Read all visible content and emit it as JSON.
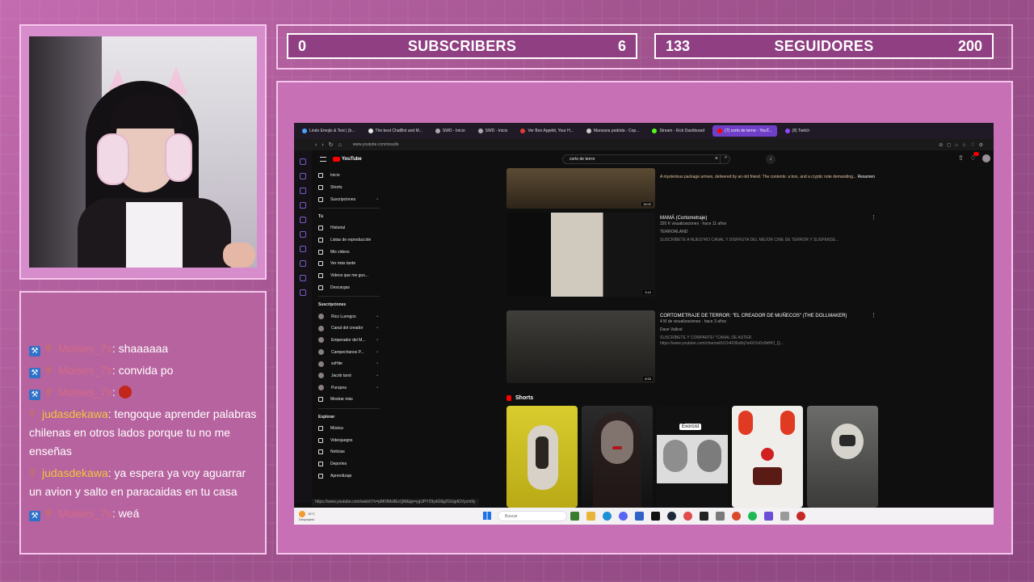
{
  "counters": {
    "youtube": {
      "current": "0",
      "label": "SUBSCRIBERS",
      "goal": "6"
    },
    "twitch": {
      "current": "133",
      "label": "SEGUIDORES",
      "goal": "200"
    }
  },
  "chat": [
    {
      "user": "Moises_7s",
      "text": ": shaaaaaa",
      "badge": true,
      "color": "#d46b86"
    },
    {
      "user": "Moises_7s",
      "text": ": convida po",
      "badge": true,
      "color": "#d46b86"
    },
    {
      "user": "Moises_7s",
      "text": ": ",
      "badge": true,
      "emote": true,
      "color": "#d46b86"
    },
    {
      "user": "judasdekawa",
      "text": ": tengoque aprender palabras chilenas en otros lados porque tu no me enseñas",
      "badge": false,
      "color": "#f2c53d"
    },
    {
      "user": "judasdekawa",
      "text": ": ya espera ya voy aguarrar un avion y salto en paracaidas en tu casa",
      "badge": false,
      "color": "#f2c53d"
    },
    {
      "user": "Moises_7s",
      "text": ": weá",
      "badge": true,
      "color": "#d46b86"
    }
  ],
  "browser": {
    "tabs": [
      {
        "label": "Lindo Emojis & Text | (b...",
        "color": "#4aa3ff"
      },
      {
        "label": "The best ChatBot and M...",
        "color": "#e9e9e9"
      },
      {
        "label": "SWD - Inicio",
        "color": "#aaaaaa"
      },
      {
        "label": "SWD - Inicio",
        "color": "#aaaaaa"
      },
      {
        "label": "Ver Bon Appétit, Your H...",
        "color": "#e53935"
      },
      {
        "label": "Manzana podrida - Cop...",
        "color": "#cccccc"
      },
      {
        "label": "Stream - Kick Dashboard",
        "color": "#53fc18"
      },
      {
        "label": "(7) corto de terror - YouT...",
        "color": "#ff0000",
        "active": true
      },
      {
        "label": "(8) Twitch",
        "color": "#9146ff"
      }
    ],
    "url": "www.youtube.com/results",
    "status_url": "https://www.youtube.com/watch?v=p8K9Mx8EcQM&pp=ygUPY29ydG8gZGUgdGVycm9y"
  },
  "youtube": {
    "logo": "YouTube",
    "search_query": "corto de terror",
    "sidebar": {
      "main": [
        "Inicio",
        "Shorts",
        "Suscripciones"
      ],
      "tu_header": "Tú",
      "you": [
        "Historial",
        "Listas de reproducción",
        "Mis videos",
        "Ver más tarde",
        "Videos que me gus..."
      ],
      "downloads": "Descargas",
      "subs_header": "Suscripciones",
      "subs": [
        "Rico Luengos",
        "Canal del creador",
        "Emperador del M...",
        "Campechanos P...",
        "sxHite",
        "Jacob tarot",
        "Purupea"
      ],
      "show_more": "Mostrar más",
      "explore_header": "Explorar",
      "explore": [
        "Música",
        "Videojuegos",
        "Noticias",
        "Deportes",
        "Aprendizaje"
      ]
    },
    "videos": [
      {
        "title": "",
        "desc": "A mysterious package arrives, delivered by an old friend. The contents: a box, and a cryptic note demanding...",
        "duration": "15:02",
        "resumen": "Resumen"
      },
      {
        "title": "MAMÁ (Cortometraje)",
        "meta": "320 K visualizaciones · hace 11 años",
        "channel": "TERRORLAND",
        "desc": "SUSCRÍBETE A NUESTRO CANAL Y DISFRUTA DEL MEJOR CINE DE TERROR Y SUSPENSE...",
        "duration": "3:10"
      },
      {
        "title": "CORTOMETRAJE DE TERROR: \"EL CREADOR DE MUÑECOS\" (THE DOLLMAKER)",
        "meta": "4 M de visualizaciones · hace 3 años",
        "channel": "Dave Vallcot",
        "desc": "SUSCRÍBETE Y COMPARTE! *CANAL DE ASTER https://www.youtube.com/channel/UCh4O9lu8q7a4XOvDc8dHO_Q...",
        "duration": "8:53"
      }
    ],
    "shorts_header": "Shorts",
    "exorcist_label": "Exorcist"
  },
  "taskbar": {
    "weather_temp": "16°C",
    "weather_desc": "Despejado",
    "search_placeholder": "Buscar"
  }
}
